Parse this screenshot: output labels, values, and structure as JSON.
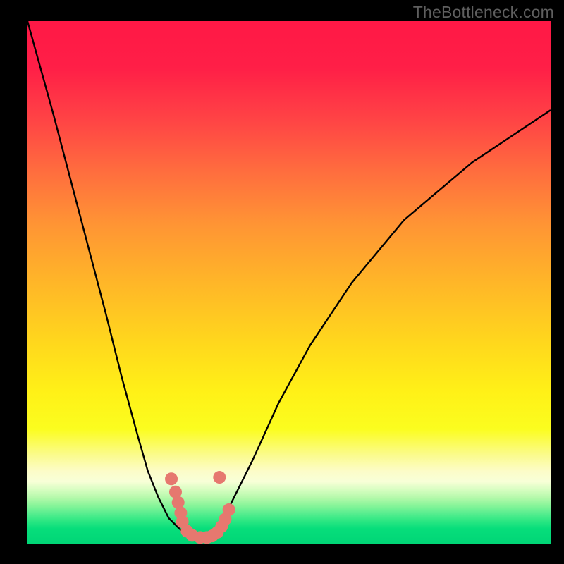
{
  "watermark": "TheBottleneck.com",
  "colors": {
    "curve": "#000000",
    "dots": "#e6786f",
    "frame": "#000000"
  },
  "chart_data": {
    "type": "line",
    "title": "",
    "xlabel": "",
    "ylabel": "",
    "xlim": [
      0,
      100
    ],
    "ylim": [
      0,
      100
    ],
    "series": [
      {
        "name": "left-curve",
        "x": [
          0,
          5,
          10,
          15,
          18,
          21,
          23,
          25,
          27,
          29,
          31,
          33
        ],
        "values": [
          100,
          82,
          63,
          44,
          32,
          21,
          14,
          9,
          5,
          3,
          1.5,
          1
        ]
      },
      {
        "name": "right-curve",
        "x": [
          33,
          36,
          39,
          43,
          48,
          54,
          62,
          72,
          85,
          100
        ],
        "values": [
          1,
          3,
          8,
          16,
          27,
          38,
          50,
          62,
          73,
          83
        ]
      }
    ],
    "scatter": {
      "name": "dots",
      "points": [
        {
          "x": 27.5,
          "y": 12.5
        },
        {
          "x": 28.3,
          "y": 10.0
        },
        {
          "x": 28.8,
          "y": 8.0
        },
        {
          "x": 29.3,
          "y": 6.0
        },
        {
          "x": 29.6,
          "y": 4.3
        },
        {
          "x": 30.5,
          "y": 2.5
        },
        {
          "x": 31.5,
          "y": 1.7
        },
        {
          "x": 33.0,
          "y": 1.3
        },
        {
          "x": 34.3,
          "y": 1.3
        },
        {
          "x": 35.3,
          "y": 1.6
        },
        {
          "x": 36.3,
          "y": 2.3
        },
        {
          "x": 37.1,
          "y": 3.4
        },
        {
          "x": 37.8,
          "y": 4.8
        },
        {
          "x": 38.5,
          "y": 6.6
        },
        {
          "x": 36.7,
          "y": 12.8
        }
      ]
    }
  }
}
